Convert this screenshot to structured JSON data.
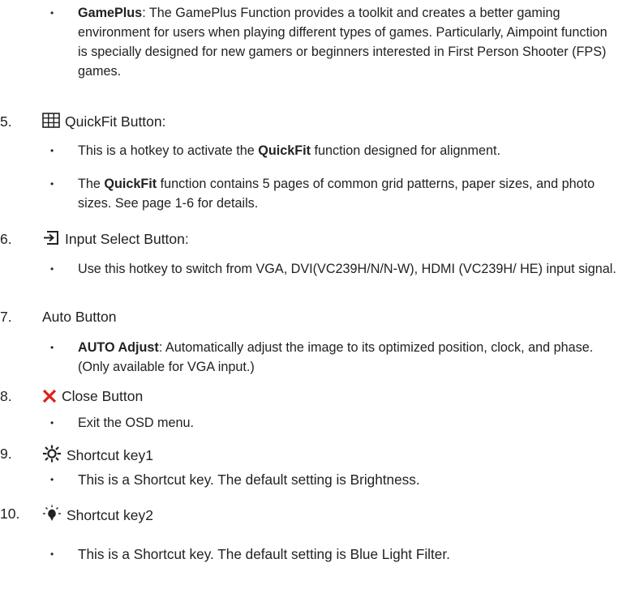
{
  "bullet_glyph": "•",
  "items": [
    {
      "bullets": [
        {
          "bold": "GamePlus",
          "text": ": The GamePlus Function provides a toolkit and creates a better gaming environment for users when playing different types of games. Particularly, Aimpoint function is specially designed for new gamers or beginners interested in First Person Shooter (FPS) games."
        }
      ]
    },
    {
      "number": "5.",
      "icon": "grid-icon",
      "label": "QuickFit Button:",
      "bullets": [
        {
          "pre": "This is a hotkey to activate the ",
          "bold": "QuickFit",
          "text": " function designed for alignment."
        },
        {
          "pre": "The ",
          "bold": "QuickFit",
          "text": " function contains 5 pages of common grid patterns, paper sizes, and photo sizes. See page 1-6 for details."
        }
      ]
    },
    {
      "number": "6.",
      "icon": "input-select-icon",
      "label": "Input Select Button:",
      "bullets": [
        {
          "text": "Use this hotkey to switch from VGA, DVI(VC239H/N/N-W), HDMI (VC239H/ HE)  input signal."
        }
      ]
    },
    {
      "number": "7.",
      "label": "Auto Button",
      "bullets": [
        {
          "bold": "AUTO Adjust",
          "text": ": Automatically adjust the image to its optimized position, clock, and phase. (Only available for VGA input.)"
        }
      ]
    },
    {
      "number": "8.",
      "icon": "close-icon",
      "label": "Close Button",
      "bullets": [
        {
          "text": "Exit the OSD menu."
        }
      ]
    },
    {
      "number": "9.",
      "icon": "brightness-icon",
      "label": "Shortcut key1",
      "bullets": [
        {
          "text": "This is a Shortcut key. The default setting is Brightness."
        }
      ]
    },
    {
      "number": "10.",
      "icon": "bulb-icon",
      "label": "Shortcut key2",
      "bullets": [
        {
          "text": "This is a Shortcut key. The default setting is Blue Light Filter."
        }
      ]
    }
  ],
  "colors": {
    "text": "#222222",
    "close_icon": "#e0201b"
  }
}
